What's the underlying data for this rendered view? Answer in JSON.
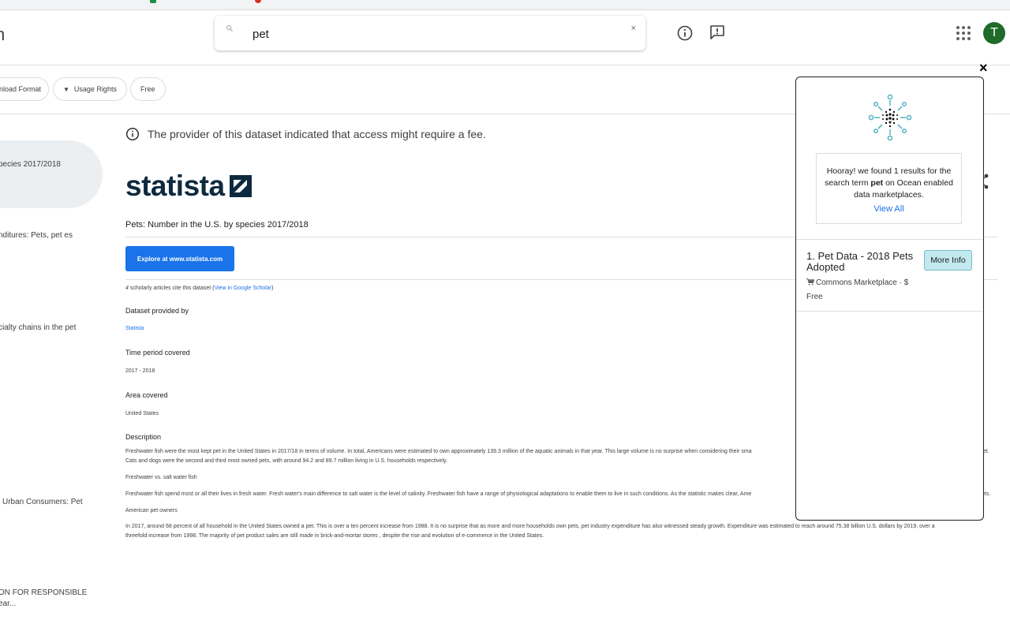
{
  "header": {
    "brand_fragment": "n",
    "search": {
      "value": "pet",
      "clear": "×"
    },
    "avatar_initial": "T"
  },
  "filters": {
    "download_format": "nload Format",
    "usage_rights": "Usage Rights",
    "free": "Free"
  },
  "sidebar": {
    "items": [
      "pecies 2017/2018",
      "nditures: Pets, pet es",
      "cialty chains in the pet",
      "l Urban Consumers: Pet",
      "ON FOR RESPONSIBLE ear..."
    ]
  },
  "dataset": {
    "notice": "The provider of this dataset indicated that access might require a fee.",
    "logo_text": "statista",
    "title": "Pets: Number in the U.S. by species 2017/2018",
    "explore_button": "Explore at www.statista.com",
    "cite_count": "4",
    "cite_text": " scholarly articles cite this dataset (",
    "cite_link": "View in Google Scholar",
    "cite_close": ")",
    "provided_by_label": "Dataset provided by",
    "provider": "Statista",
    "time_label": "Time period covered",
    "time_value": "2017 - 2018",
    "area_label": "Area covered",
    "area_value": "United States",
    "description_label": "Description",
    "description": [
      "Freshwater fish were the most kept pet in the United States in 2017/18 in terms of volume. In total, Americans were estimated to own approximately 139.3 million of the aquatic animals in that year. This large volume is no surprise when considering their sma",
      "et.",
      "Cats and dogs were the second and third most owned pets, with around 94.2 and 89.7 million living in U.S. households respectively.",
      "Freshwater vs. salt water fish",
      "Freshwater fish spend most or all their lives in fresh water. Fresh water's main difference to salt water is the level of salinity. Freshwater fish have a range of physiological adaptations to enable them to live in such conditions. As the statistic makes clear, Ame",
      "ets.",
      "American pet owners",
      "In 2017, around 68 percent of all household in the United States owned a pet. This is over a ten percent increase from 1988. It is no surprise that as more and more households own pets, pet industry expenditure has also witnessed steady growth. Expenditure was estimated to reach around 75.38 billion U.S. dollars by 2019, over a",
      "threefold increase from 1998. The majority of pet product sales are still made in brick-and-mortar stores , despite the rise and evolution of e-commerce in the United States."
    ]
  },
  "ocean_panel": {
    "close": "×",
    "hooray_pre": "Hooray! we found 1 results for the search term ",
    "hooray_term": "pet",
    "hooray_post": " on Ocean enabled data marketplaces.",
    "view_all": "View All",
    "result": {
      "title": "1. Pet Data - 2018 Pets Adopted",
      "more_info": "More Info",
      "marketplace": "Commons Marketplace · $",
      "price": "Free"
    }
  },
  "colors": {
    "accent": "#1a73e8",
    "avatar": "#1e6b2a",
    "ocean_teal": "#5bb8c4",
    "more_info_bg": "#c3e9f0"
  }
}
